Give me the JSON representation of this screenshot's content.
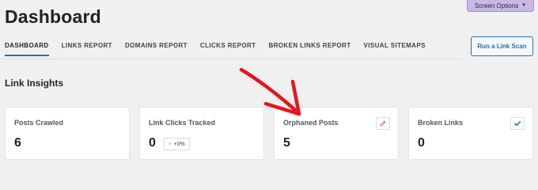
{
  "screen_options": {
    "label": "Screen Options",
    "caret": "▼"
  },
  "page_title": "Dashboard",
  "tabs": [
    {
      "label": "DASHBOARD",
      "active": true
    },
    {
      "label": "LINKS REPORT"
    },
    {
      "label": "DOMAINS REPORT"
    },
    {
      "label": "CLICKS REPORT"
    },
    {
      "label": "BROKEN LINKS REPORT"
    },
    {
      "label": "VISUAL SITEMAPS"
    }
  ],
  "scan_button": {
    "label": "Run a Link Scan"
  },
  "section": {
    "title": "Link Insights"
  },
  "cards": [
    {
      "label": "Posts Crawled",
      "value": "6"
    },
    {
      "label": "Link Clicks Tracked",
      "value": "0",
      "badge": {
        "arrow": "↑",
        "text": "+0%"
      }
    },
    {
      "label": "Orphaned Posts",
      "value": "5",
      "icon": "pencil-icon"
    },
    {
      "label": "Broken Links",
      "value": "0",
      "icon": "check-icon"
    }
  ],
  "colors": {
    "accent": "#2271b1",
    "screen_options_bg": "#c9b7e6",
    "annotation_arrow": "#e8141a",
    "pencil_icon": "#e06b5a",
    "check_icon": "#1f8a3a"
  }
}
